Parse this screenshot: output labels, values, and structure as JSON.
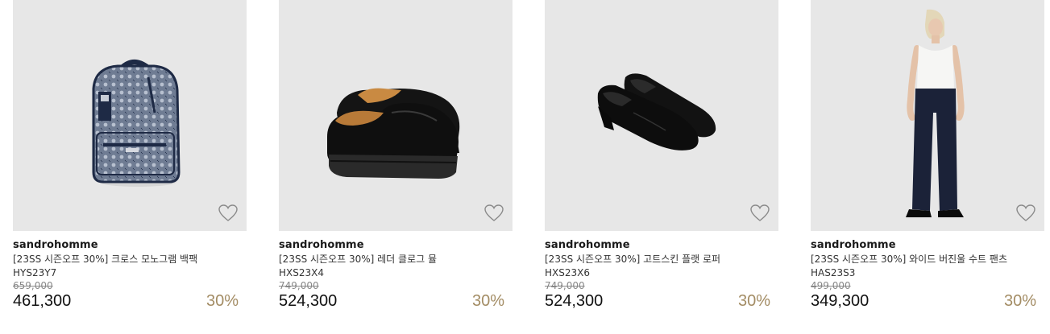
{
  "products": [
    {
      "brand": "sandrohomme",
      "name": "[23SS 시즌오프 30%] 크로스 모노그램 백팩",
      "code": "HYS23Y7",
      "original_price": "659,000",
      "price": "461,300",
      "discount": "30%",
      "image_icon": "backpack-image"
    },
    {
      "brand": "sandrohomme",
      "name": "[23SS 시즌오프 30%] 레더 클로그 뮬",
      "code": "HXS23X4",
      "original_price": "749,000",
      "price": "524,300",
      "discount": "30%",
      "image_icon": "mule-shoes-image"
    },
    {
      "brand": "sandrohomme",
      "name": "[23SS 시즌오프 30%] 고트스킨 플랫 로퍼",
      "code": "HXS23X6",
      "original_price": "749,000",
      "price": "524,300",
      "discount": "30%",
      "image_icon": "loafers-image"
    },
    {
      "brand": "sandrohomme",
      "name": "[23SS 시즌오프 30%] 와이드 버진울 수트 팬츠",
      "code": "HAS23S3",
      "original_price": "499,000",
      "price": "349,300",
      "discount": "30%",
      "image_icon": "model-pants-image"
    }
  ],
  "colors": {
    "thumb_bg": "#e7e7e7",
    "discount": "#a38c64"
  }
}
